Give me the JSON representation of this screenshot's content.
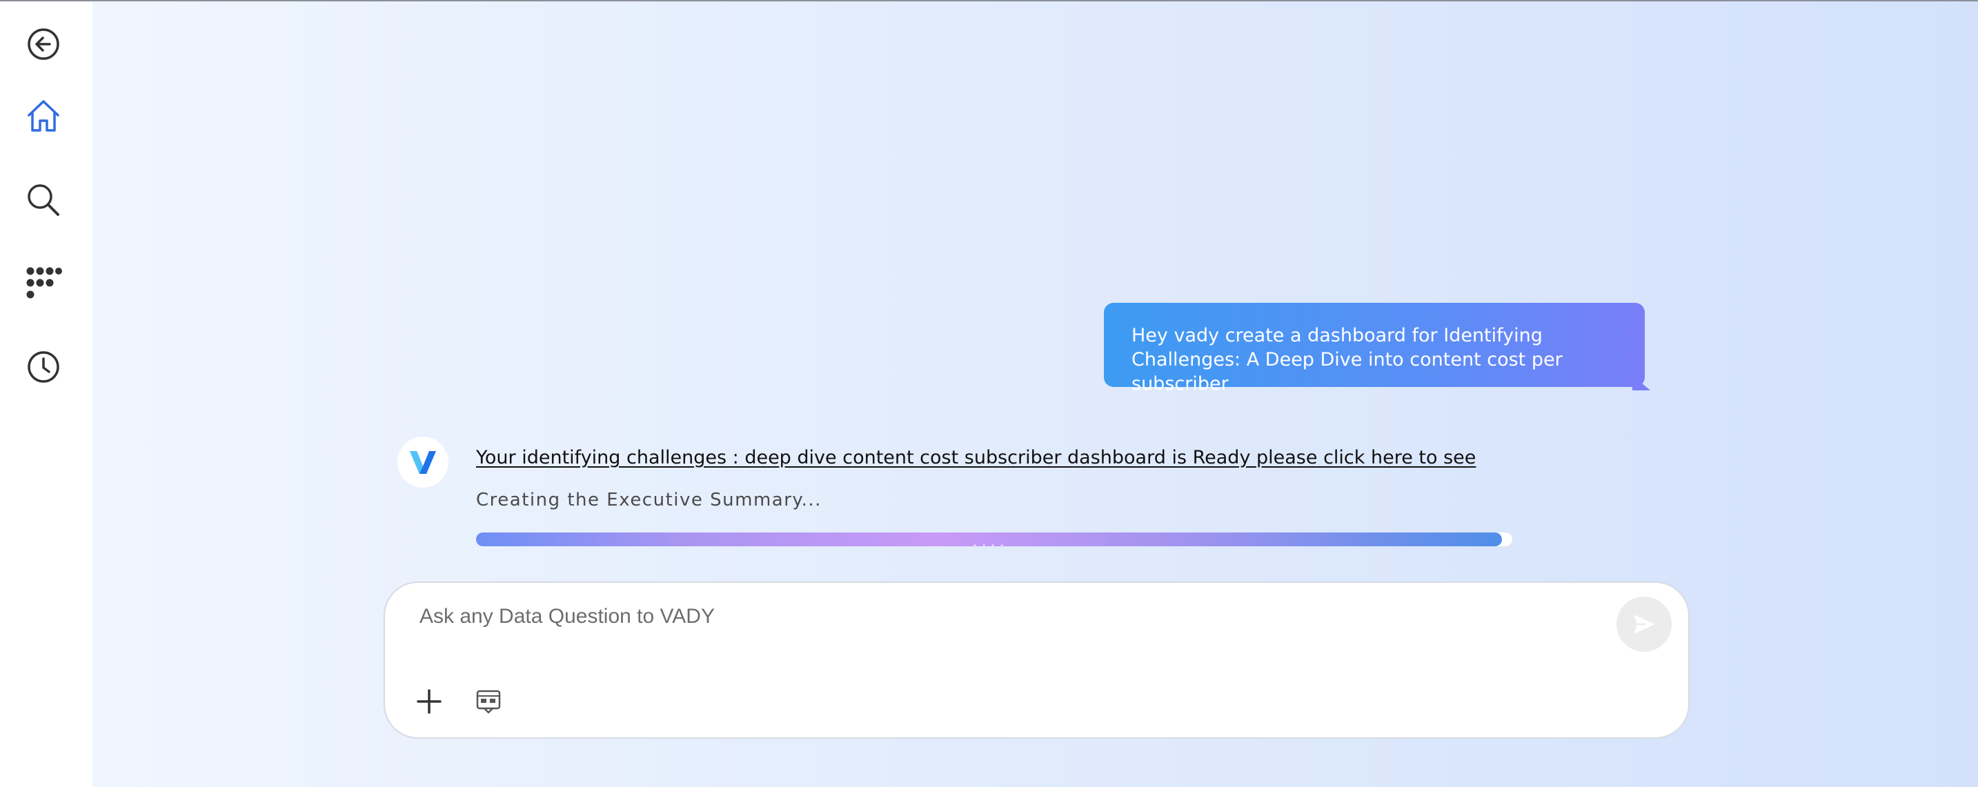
{
  "sidebar": {
    "items": [
      {
        "id": "back",
        "icon": "back-arrow-icon"
      },
      {
        "id": "home",
        "icon": "home-icon",
        "active": true
      },
      {
        "id": "search",
        "icon": "search-icon"
      },
      {
        "id": "apps",
        "icon": "dots-grid-icon"
      },
      {
        "id": "history",
        "icon": "clock-icon"
      }
    ],
    "active_color": "#2f6de0",
    "icon_color": "#333333"
  },
  "conversation": {
    "user_message": "Hey vady create a dashboard for Identifying Challenges: A Deep Dive into content cost per subscriber",
    "assistant_link": "Your identifying challenges : deep dive content cost subscriber dashboard is Ready please click here to see",
    "status": "Creating the Executive Summary...",
    "progress": 0.99
  },
  "composer": {
    "placeholder": "Ask any Data Question to VADY",
    "value": ""
  },
  "colors": {
    "bubble_start": "#3d9bf2",
    "bubble_end": "#7a7ef8",
    "logo_blue": "#1e73e8",
    "logo_light": "#4fc3f7"
  }
}
